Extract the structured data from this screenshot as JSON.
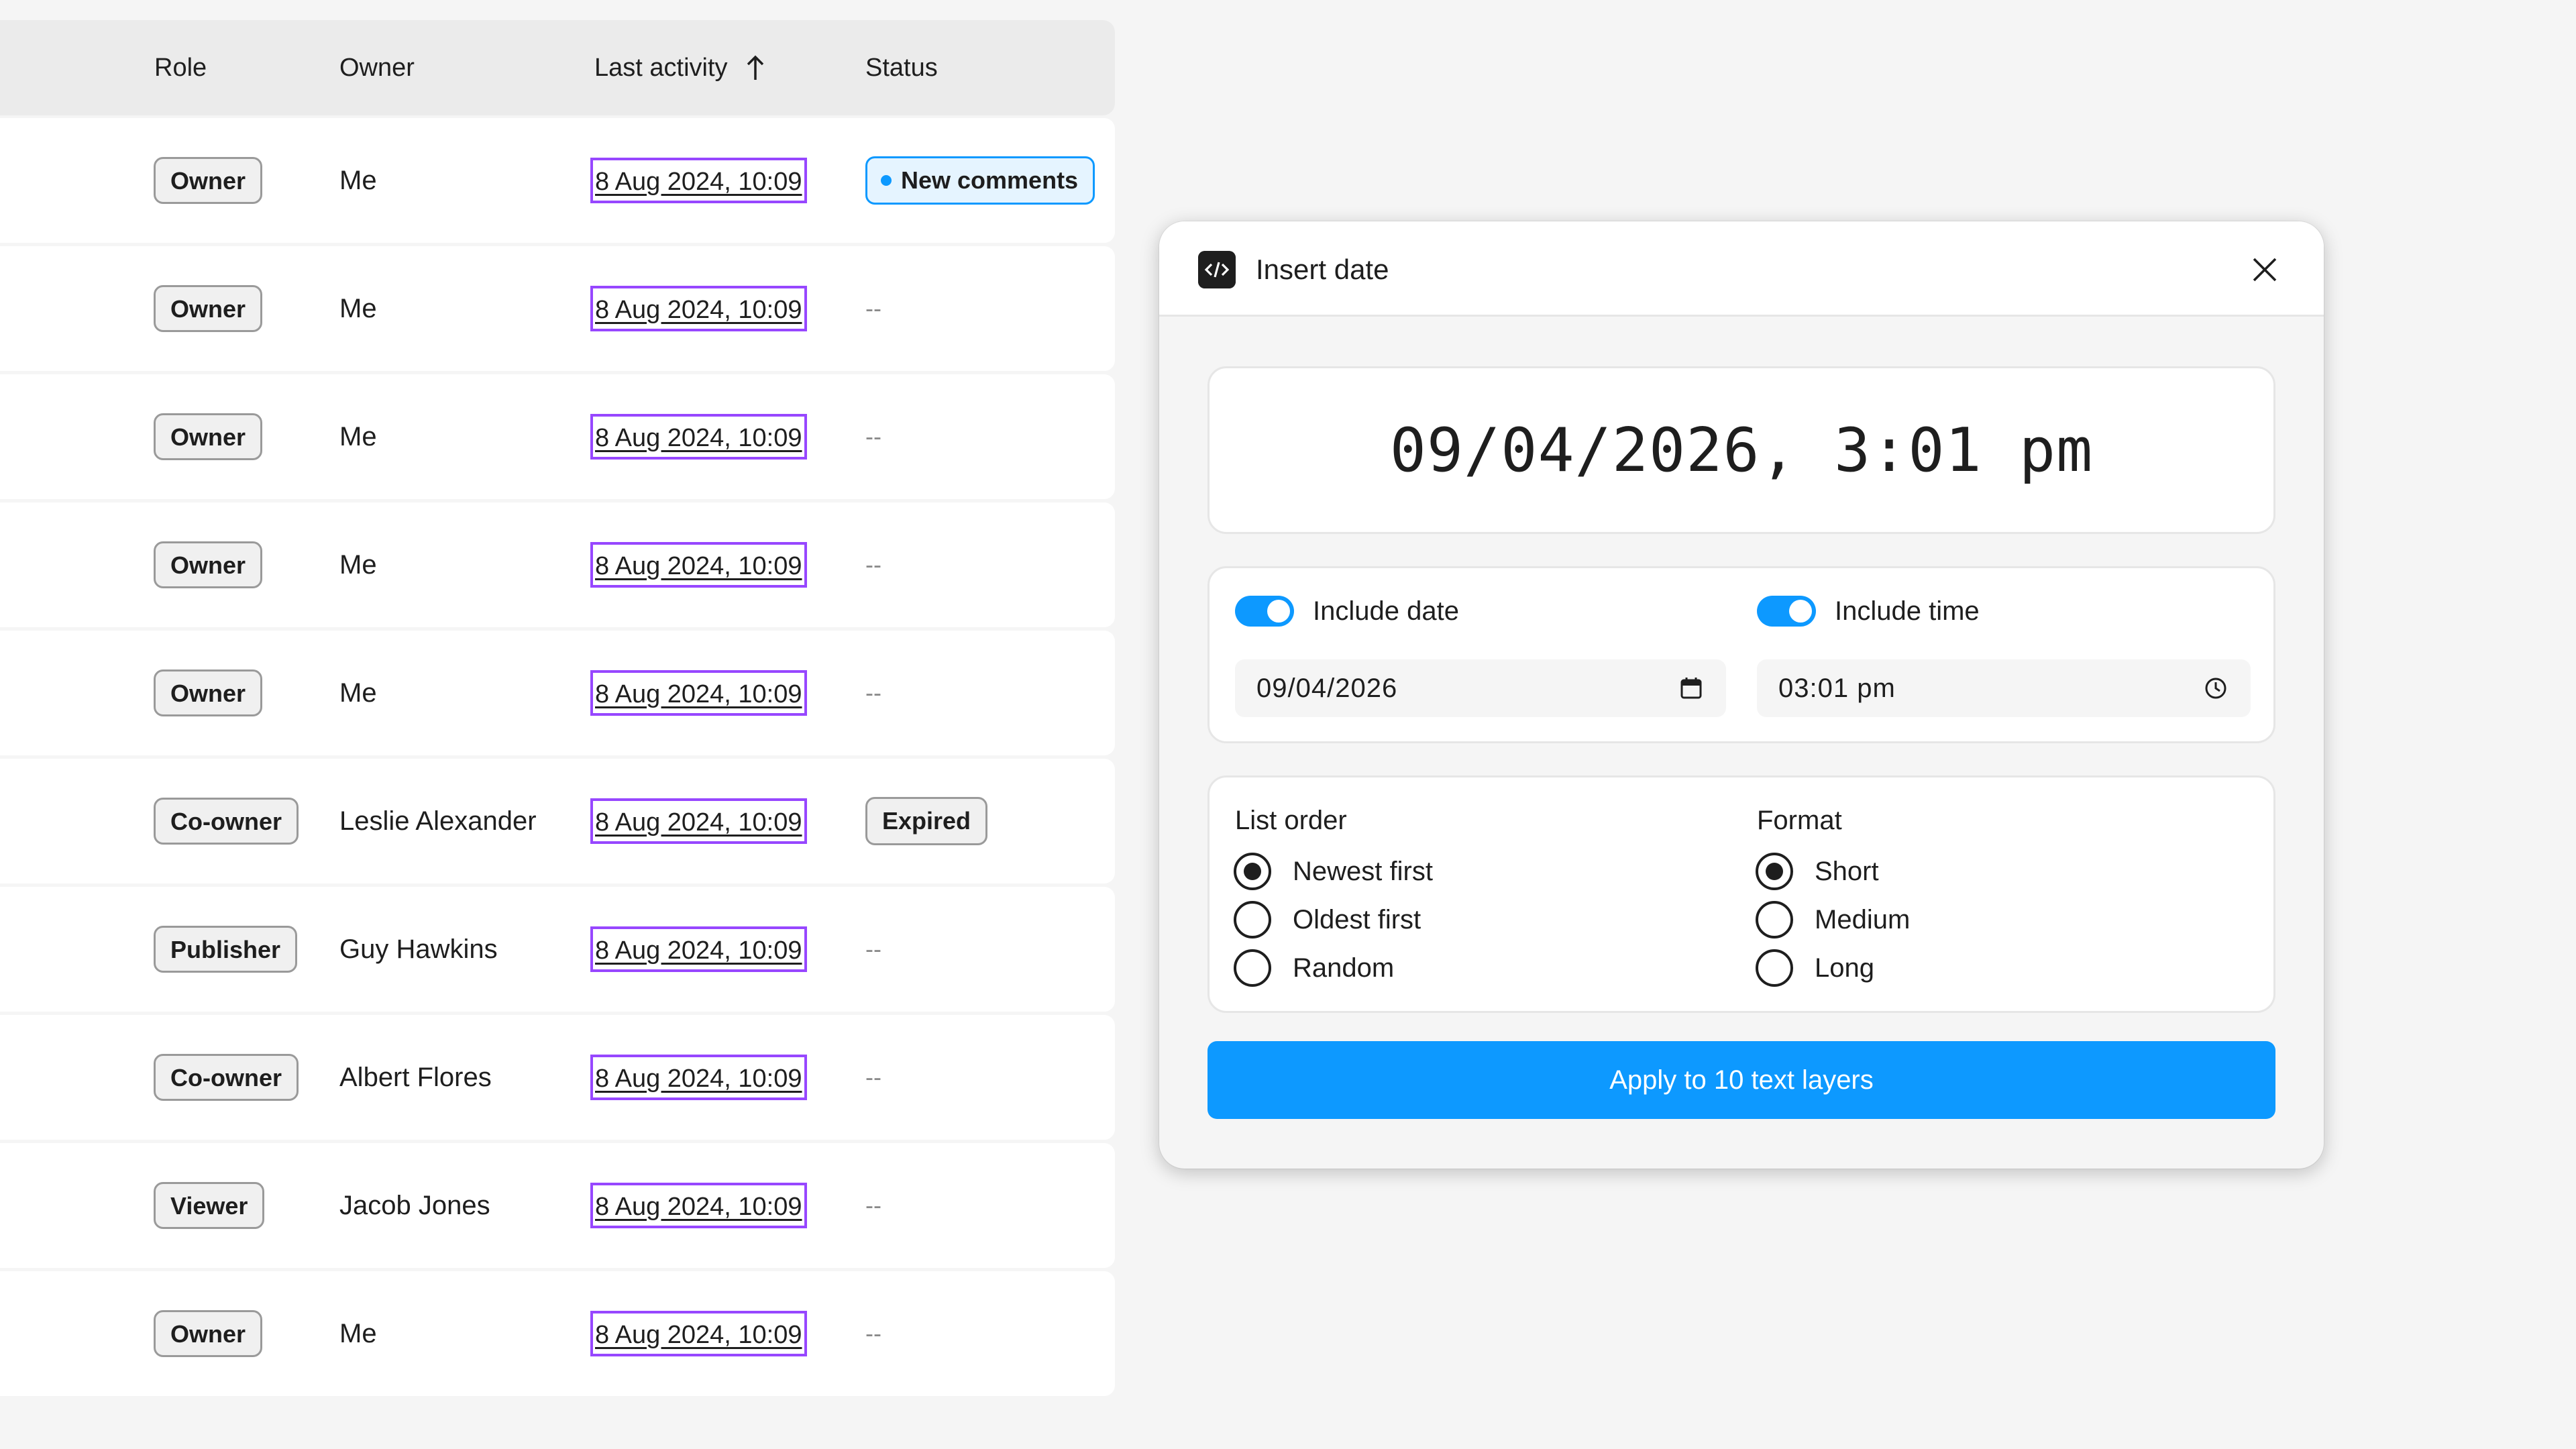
{
  "colors": {
    "accent": "#0d99ff",
    "selection_outline": "#9747ff",
    "badge_border": "#9a9a9a",
    "text": "#1e1e1e"
  },
  "table": {
    "headers": {
      "role": "Role",
      "owner": "Owner",
      "last_activity": "Last activity",
      "status": "Status",
      "sort_icon": "arrow-up-icon"
    },
    "rows": [
      {
        "role": "Owner",
        "owner": "Me",
        "last_activity": "8 Aug 2024, 10:09",
        "status": "New comments",
        "status_type": "new"
      },
      {
        "role": "Owner",
        "owner": "Me",
        "last_activity": "8 Aug 2024, 10:09",
        "status": "--",
        "status_type": "empty"
      },
      {
        "role": "Owner",
        "owner": "Me",
        "last_activity": "8 Aug 2024, 10:09",
        "status": "--",
        "status_type": "empty"
      },
      {
        "role": "Owner",
        "owner": "Me",
        "last_activity": "8 Aug 2024, 10:09",
        "status": "--",
        "status_type": "empty"
      },
      {
        "role": "Owner",
        "owner": "Me",
        "last_activity": "8 Aug 2024, 10:09",
        "status": "--",
        "status_type": "empty"
      },
      {
        "role": "Co-owner",
        "owner": "Leslie Alexander",
        "last_activity": "8 Aug 2024, 10:09",
        "status": "Expired",
        "status_type": "expired"
      },
      {
        "role": "Publisher",
        "owner": "Guy Hawkins",
        "last_activity": "8 Aug 2024, 10:09",
        "status": "--",
        "status_type": "empty"
      },
      {
        "role": "Co-owner",
        "owner": "Albert Flores",
        "last_activity": "8 Aug 2024, 10:09",
        "status": "--",
        "status_type": "empty"
      },
      {
        "role": "Viewer",
        "owner": "Jacob Jones",
        "last_activity": "8 Aug 2024, 10:09",
        "status": "--",
        "status_type": "empty"
      },
      {
        "role": "Owner",
        "owner": "Me",
        "last_activity": "8 Aug 2024, 10:09",
        "status": "--",
        "status_type": "empty"
      }
    ]
  },
  "dialog": {
    "title": "Insert date",
    "title_icon": "code-icon",
    "close_icon": "close-icon",
    "preview": "09/04/2026, 3:01 pm",
    "include_date": {
      "label": "Include date",
      "on": true,
      "value": "09/04/2026",
      "icon": "calendar-icon"
    },
    "include_time": {
      "label": "Include time",
      "on": true,
      "value": "03:01 pm",
      "icon": "clock-icon"
    },
    "list_order": {
      "label": "List order",
      "options": [
        "Newest first",
        "Oldest first",
        "Random"
      ],
      "selected": "Newest first"
    },
    "format": {
      "label": "Format",
      "options": [
        "Short",
        "Medium",
        "Long"
      ],
      "selected": "Short"
    },
    "apply_label": "Apply to 10 text layers"
  }
}
